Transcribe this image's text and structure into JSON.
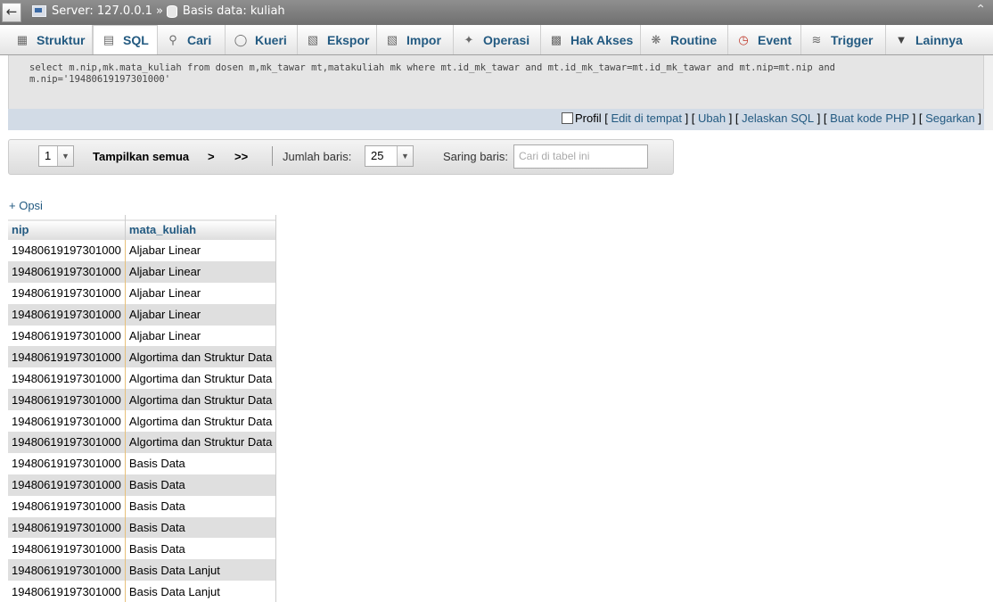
{
  "breadcrumb": {
    "server_label": "Server: 127.0.0.1",
    "separator": "»",
    "db_label": "Basis data: kuliah"
  },
  "tabs": [
    {
      "label": "Struktur",
      "icon": "table-structure-icon"
    },
    {
      "label": "SQL",
      "icon": "sql-icon",
      "active": true
    },
    {
      "label": "Cari",
      "icon": "search-icon"
    },
    {
      "label": "Kueri",
      "icon": "query-icon"
    },
    {
      "label": "Ekspor",
      "icon": "export-icon"
    },
    {
      "label": "Impor",
      "icon": "import-icon"
    },
    {
      "label": "Operasi",
      "icon": "wrench-icon"
    },
    {
      "label": "Hak Akses",
      "icon": "privileges-icon"
    },
    {
      "label": "Routine",
      "icon": "routine-icon"
    },
    {
      "label": "Event",
      "icon": "clock-icon"
    },
    {
      "label": "Trigger",
      "icon": "trigger-icon"
    },
    {
      "label": "Lainnya",
      "icon": "caret-down-icon"
    }
  ],
  "sql": {
    "line1": "select m.nip,mk.mata_kuliah from dosen m,mk_tawar mt,matakuliah mk where mt.id_mk_tawar and mt.id_mk_tawar=mt.id_mk_tawar and mt.nip=mt.nip and",
    "line2": "m.nip='19480619197301000'",
    "profile_label": "Profil",
    "links": [
      "Edit di tempat",
      "Ubah",
      "Jelaskan SQL",
      "Buat kode PHP",
      "Segarkan"
    ]
  },
  "nav": {
    "page_value": "1",
    "show_all": "Tampilkan semua",
    "next": ">",
    "last": ">>",
    "rows_label": "Jumlah baris:",
    "rows_value": "25",
    "filter_label": "Saring baris:",
    "filter_placeholder": "Cari di tabel ini"
  },
  "options_label": "+ Opsi",
  "table": {
    "headers": [
      "nip",
      "mata_kuliah"
    ],
    "rows": [
      [
        "19480619197301000",
        "Aljabar Linear"
      ],
      [
        "19480619197301000",
        "Aljabar Linear"
      ],
      [
        "19480619197301000",
        "Aljabar Linear"
      ],
      [
        "19480619197301000",
        "Aljabar Linear"
      ],
      [
        "19480619197301000",
        "Aljabar Linear"
      ],
      [
        "19480619197301000",
        "Algortima dan Struktur Data"
      ],
      [
        "19480619197301000",
        "Algortima dan Struktur Data"
      ],
      [
        "19480619197301000",
        "Algortima dan Struktur Data"
      ],
      [
        "19480619197301000",
        "Algortima dan Struktur Data"
      ],
      [
        "19480619197301000",
        "Algortima dan Struktur Data"
      ],
      [
        "19480619197301000",
        "Basis Data"
      ],
      [
        "19480619197301000",
        "Basis Data"
      ],
      [
        "19480619197301000",
        "Basis Data"
      ],
      [
        "19480619197301000",
        "Basis Data"
      ],
      [
        "19480619197301000",
        "Basis Data"
      ],
      [
        "19480619197301000",
        "Basis Data Lanjut"
      ],
      [
        "19480619197301000",
        "Basis Data Lanjut"
      ]
    ]
  }
}
